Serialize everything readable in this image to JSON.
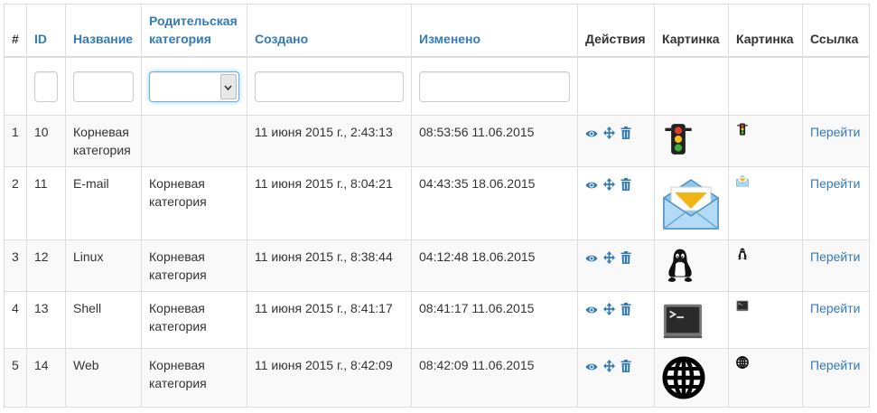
{
  "headers": {
    "num": "#",
    "id": "ID",
    "name": "Название",
    "parent": "Родительская категория",
    "created": "Создано",
    "updated": "Изменено",
    "actions": "Действия",
    "image_large": "Картинка",
    "image_small": "Картинка",
    "link": "Ссылка"
  },
  "filters": {
    "id": "",
    "name": "",
    "parent": "",
    "created": "",
    "updated": ""
  },
  "rows": [
    {
      "num": "1",
      "id": "10",
      "name": "Корневая категория",
      "parent": "",
      "created": "11 июня 2015 г., 2:43:13",
      "updated": "08:53:56 11.06.2015",
      "icon": "traffic-light",
      "link": "Перейти"
    },
    {
      "num": "2",
      "id": "11",
      "name": "E-mail",
      "parent": "Корневая категория",
      "created": "11 июня 2015 г., 8:04:21",
      "updated": "04:43:35 18.06.2015",
      "icon": "envelope",
      "link": "Перейти"
    },
    {
      "num": "3",
      "id": "12",
      "name": "Linux",
      "parent": "Корневая категория",
      "created": "11 июня 2015 г., 8:38:44",
      "updated": "04:12:48 18.06.2015",
      "icon": "tux",
      "link": "Перейти"
    },
    {
      "num": "4",
      "id": "13",
      "name": "Shell",
      "parent": "Корневая категория",
      "created": "11 июня 2015 г., 8:41:17",
      "updated": "08:41:17 11.06.2015",
      "icon": "terminal",
      "link": "Перейти"
    },
    {
      "num": "5",
      "id": "14",
      "name": "Web",
      "parent": "Корневая категория",
      "created": "11 июня 2015 г., 8:42:09",
      "updated": "08:42:09 11.06.2015",
      "icon": "globe",
      "link": "Перейти"
    }
  ],
  "colors": {
    "link": "#337ab7",
    "stripe": "#f9f9f9",
    "border": "#dddddd"
  }
}
